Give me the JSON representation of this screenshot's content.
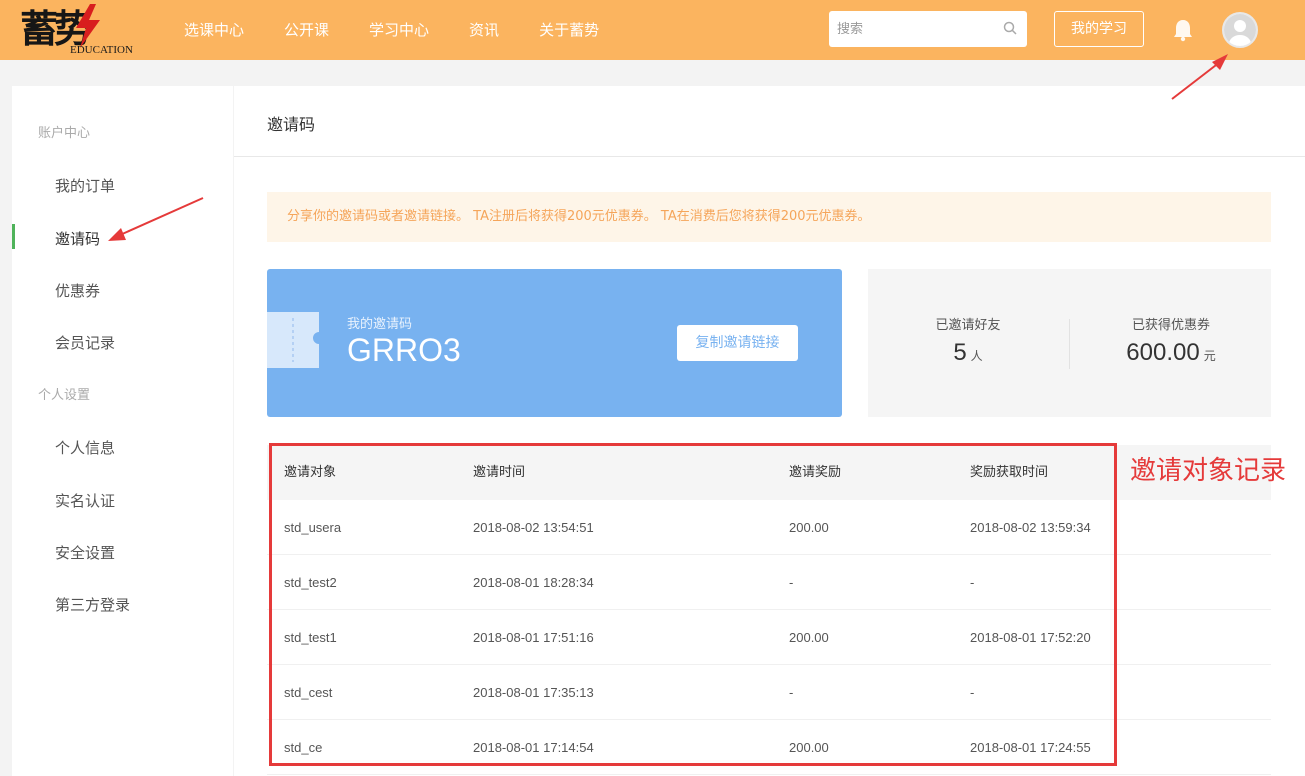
{
  "header": {
    "logo_glyph": "蓄势",
    "logo_subtitle": "EDUCATION",
    "nav": [
      "选课中心",
      "公开课",
      "学习中心",
      "资讯",
      "关于蓄势"
    ],
    "search_placeholder": "搜索",
    "my_study_label": "我的学习",
    "accent_color": "#fbb45f"
  },
  "sidebar": {
    "sections": [
      {
        "title": "账户中心",
        "items": [
          "我的订单",
          "邀请码",
          "优惠券",
          "会员记录"
        ]
      },
      {
        "title": "个人设置",
        "items": [
          "个人信息",
          "实名认证",
          "安全设置",
          "第三方登录"
        ]
      }
    ],
    "active_item": "邀请码",
    "active_color": "#4fb35a"
  },
  "main": {
    "title": "邀请码",
    "notice": "分享你的邀请码或者邀请链接。 TA注册后将获得200元优惠券。 TA在消费后您将获得200元优惠券。",
    "code_card": {
      "label": "我的邀请码",
      "code": "GRRO3",
      "copy_button": "复制邀请链接"
    },
    "stats": {
      "invited_label": "已邀请好友",
      "invited_value": "5",
      "invited_unit": "人",
      "coupon_label": "已获得优惠券",
      "coupon_value": "600.00",
      "coupon_unit": "元"
    },
    "table": {
      "headers": [
        "邀请对象",
        "邀请时间",
        "邀请奖励",
        "奖励获取时间"
      ],
      "rows": [
        [
          "std_usera",
          "2018-08-02 13:54:51",
          "200.00",
          "2018-08-02 13:59:34"
        ],
        [
          "std_test2",
          "2018-08-01 18:28:34",
          "-",
          "-"
        ],
        [
          "std_test1",
          "2018-08-01 17:51:16",
          "200.00",
          "2018-08-01 17:52:20"
        ],
        [
          "std_cest",
          "2018-08-01 17:35:13",
          "-",
          "-"
        ],
        [
          "std_ce",
          "2018-08-01 17:14:54",
          "200.00",
          "2018-08-01 17:24:55"
        ]
      ]
    }
  },
  "annotations": {
    "table_label": "邀请对象记录",
    "color": "#e53a3a"
  }
}
